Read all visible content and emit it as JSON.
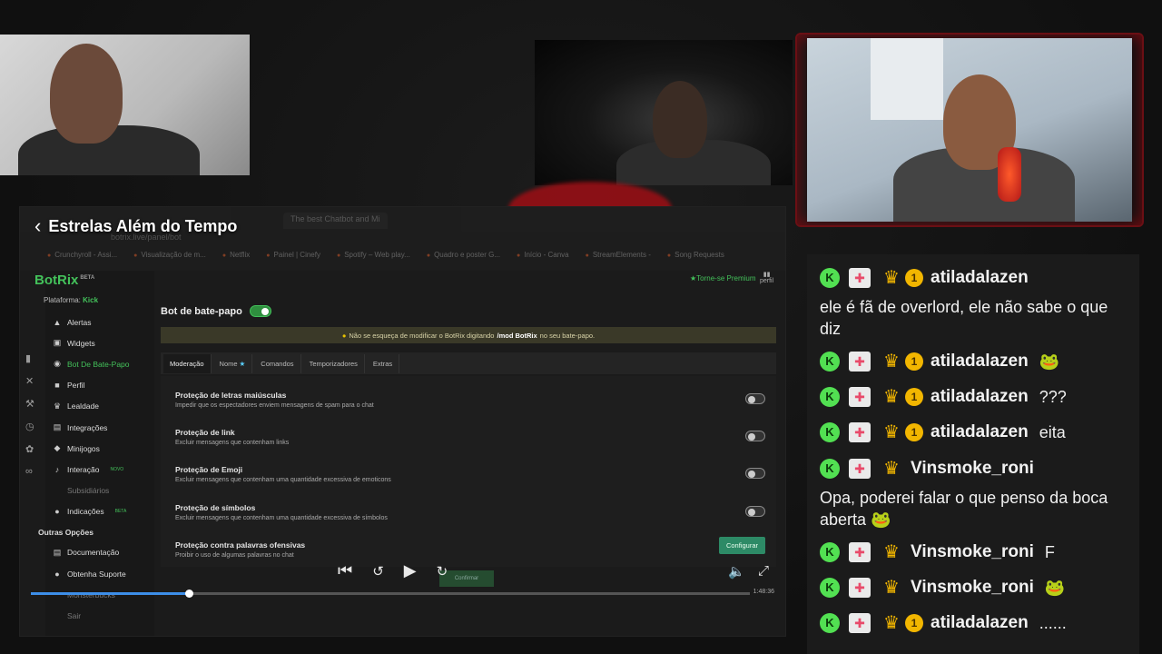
{
  "player": {
    "title": "Estrelas Além do Tempo",
    "elapsed_fraction": 0.22,
    "time_label": "1:48:36",
    "browser": {
      "tabs": [
        "The best Chatbot and Mi"
      ],
      "url": "botrix.live/panel/bot",
      "bookmarks": [
        "Crunchyroll - Assi...",
        "Visualização de m...",
        "Netflix",
        "Painel | Cinefy",
        "Spotify – Web play...",
        "Quadro e poster G...",
        "Início - Canva",
        "StreamElements -",
        "Song Requests"
      ]
    }
  },
  "app": {
    "logo": "BotRix",
    "logo_badge": "BETA",
    "platform_label": "Plataforma:",
    "platform_value": "Kick",
    "premium": "Torne-se Premium",
    "profile": "perfil",
    "nav": [
      {
        "label": "Alertas",
        "icon": "alert-icon",
        "glyph": "▲",
        "state": "normal",
        "tag": ""
      },
      {
        "label": "Widgets",
        "icon": "widget-icon",
        "glyph": "▣",
        "state": "normal",
        "tag": ""
      },
      {
        "label": "Bot De Bate-Papo",
        "icon": "chat-icon",
        "glyph": "◉",
        "state": "active",
        "tag": ""
      },
      {
        "label": "Perfil",
        "icon": "profile-icon",
        "glyph": "■",
        "state": "normal",
        "tag": ""
      },
      {
        "label": "Lealdade",
        "icon": "trophy-icon",
        "glyph": "♛",
        "state": "normal",
        "tag": ""
      },
      {
        "label": "Integrações",
        "icon": "integrations-icon",
        "glyph": "▤",
        "state": "normal",
        "tag": ""
      },
      {
        "label": "Minijogos",
        "icon": "gamepad-icon",
        "glyph": "◆",
        "state": "normal",
        "tag": ""
      },
      {
        "label": "Interação",
        "icon": "music-icon",
        "glyph": "♪",
        "state": "normal",
        "tag": "NOVO"
      },
      {
        "label": "Subsidiários",
        "icon": "",
        "glyph": "",
        "state": "dim",
        "tag": ""
      },
      {
        "label": "Indicações",
        "icon": "users-icon",
        "glyph": "●",
        "state": "normal",
        "tag": "BETA"
      }
    ],
    "other_section": "Outras Opções",
    "other": [
      {
        "label": "Documentação",
        "icon": "doc-icon",
        "glyph": "▤",
        "state": "normal"
      },
      {
        "label": "Obtenha Suporte",
        "icon": "help-icon",
        "glyph": "●",
        "state": "normal"
      },
      {
        "label": "Monsterbucks",
        "icon": "",
        "glyph": "",
        "state": "dim"
      },
      {
        "label": "Sair",
        "icon": "",
        "glyph": "",
        "state": "dim"
      }
    ],
    "content_title": "Bot de bate-papo",
    "notice_pre": "Não se esqueça de modificar o BotRix digitando",
    "notice_cmd": "/mod BotRix",
    "notice_post": "no seu bate-papo.",
    "tabs": [
      "Moderação",
      "Nome",
      "Comandos",
      "Temporizadores",
      "Extras"
    ],
    "settings": [
      {
        "title": "Proteção de letras maiúsculas",
        "desc": "Impedir que os espectadores enviem mensagens de spam para o chat"
      },
      {
        "title": "Proteção de link",
        "desc": "Excluir mensagens que contenham links"
      },
      {
        "title": "Proteção de Emoji",
        "desc": "Excluir mensagens que contenham uma quantidade excessiva de emoticons"
      },
      {
        "title": "Proteção de símbolos",
        "desc": "Excluir mensagens que contenham uma quantidade excessiva de símbolos"
      },
      {
        "title": "Proteção contra palavras ofensivas",
        "desc": "Proibir o uso de algumas palavras no chat"
      }
    ],
    "configure": "Configurar",
    "confirm": "Confirmar"
  },
  "chat": {
    "messages": [
      {
        "user": "atiladalazen",
        "level": "1",
        "text": "ele é fã de overlord, ele não sabe o que diz",
        "inline": ""
      },
      {
        "user": "atiladalazen",
        "level": "1",
        "text": "",
        "inline": "🐸"
      },
      {
        "user": "atiladalazen",
        "level": "1",
        "text": "",
        "inline": "???"
      },
      {
        "user": "atiladalazen",
        "level": "1",
        "text": "",
        "inline": "eita"
      },
      {
        "user": "Vinsmoke_roni",
        "level": "",
        "text": "Opa, poderei falar o que penso da boca aberta 🐸",
        "inline": ""
      },
      {
        "user": "Vinsmoke_roni",
        "level": "",
        "text": "",
        "inline": "F"
      },
      {
        "user": "Vinsmoke_roni",
        "level": "",
        "text": "",
        "inline": "🐸"
      },
      {
        "user": "atiladalazen",
        "level": "1",
        "text": "",
        "inline": "......"
      }
    ]
  }
}
